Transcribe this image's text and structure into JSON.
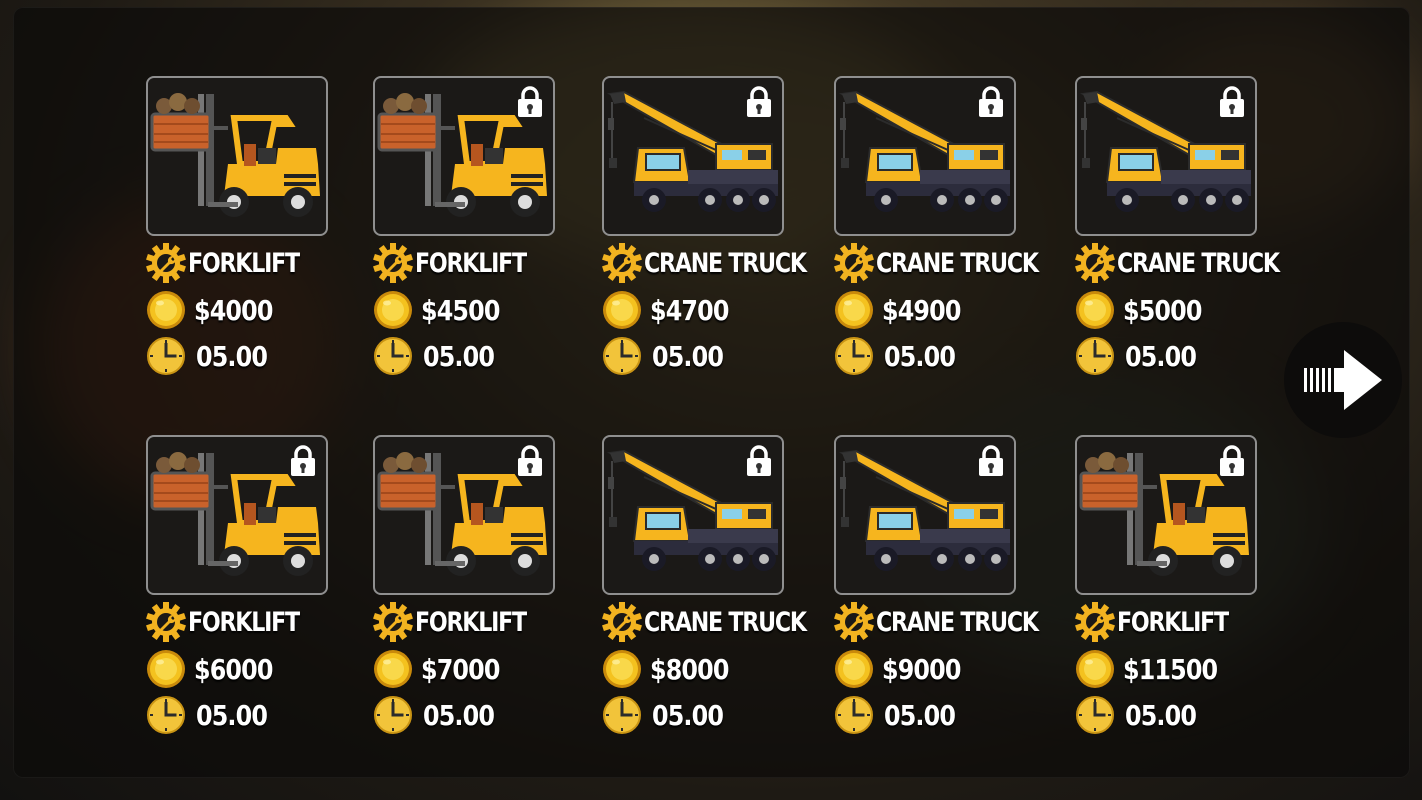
{
  "vehicles": [
    {
      "name": "FORKLIFT",
      "price": "$4000",
      "time": "05.00",
      "type": "forklift",
      "locked": false
    },
    {
      "name": "FORKLIFT",
      "price": "$4500",
      "time": "05.00",
      "type": "forklift",
      "locked": true
    },
    {
      "name": "CRANE TRUCK",
      "price": "$4700",
      "time": "05.00",
      "type": "crane",
      "locked": true
    },
    {
      "name": "CRANE TRUCK",
      "price": "$4900",
      "time": "05.00",
      "type": "crane",
      "locked": true
    },
    {
      "name": "CRANE TRUCK",
      "price": "$5000",
      "time": "05.00",
      "type": "crane",
      "locked": true
    },
    {
      "name": "FORKLIFT",
      "price": "$6000",
      "time": "05.00",
      "type": "forklift",
      "locked": true
    },
    {
      "name": "FORKLIFT",
      "price": "$7000",
      "time": "05.00",
      "type": "forklift",
      "locked": true
    },
    {
      "name": "CRANE TRUCK",
      "price": "$8000",
      "time": "05.00",
      "type": "crane",
      "locked": true
    },
    {
      "name": "CRANE TRUCK",
      "price": "$9000",
      "time": "05.00",
      "type": "crane",
      "locked": true
    },
    {
      "name": "FORKLIFT",
      "price": "$11500",
      "time": "05.00",
      "type": "forklift",
      "locked": true
    }
  ],
  "icons": {
    "name": "gear-wrench-icon",
    "price": "coin-icon",
    "time": "clock-icon",
    "lock": "lock-icon",
    "next": "arrow-right-icon"
  },
  "colors": {
    "accent_gold": "#f2b320",
    "vehicle_yellow": "#f6b51e",
    "panel": "#0c0b0a"
  }
}
